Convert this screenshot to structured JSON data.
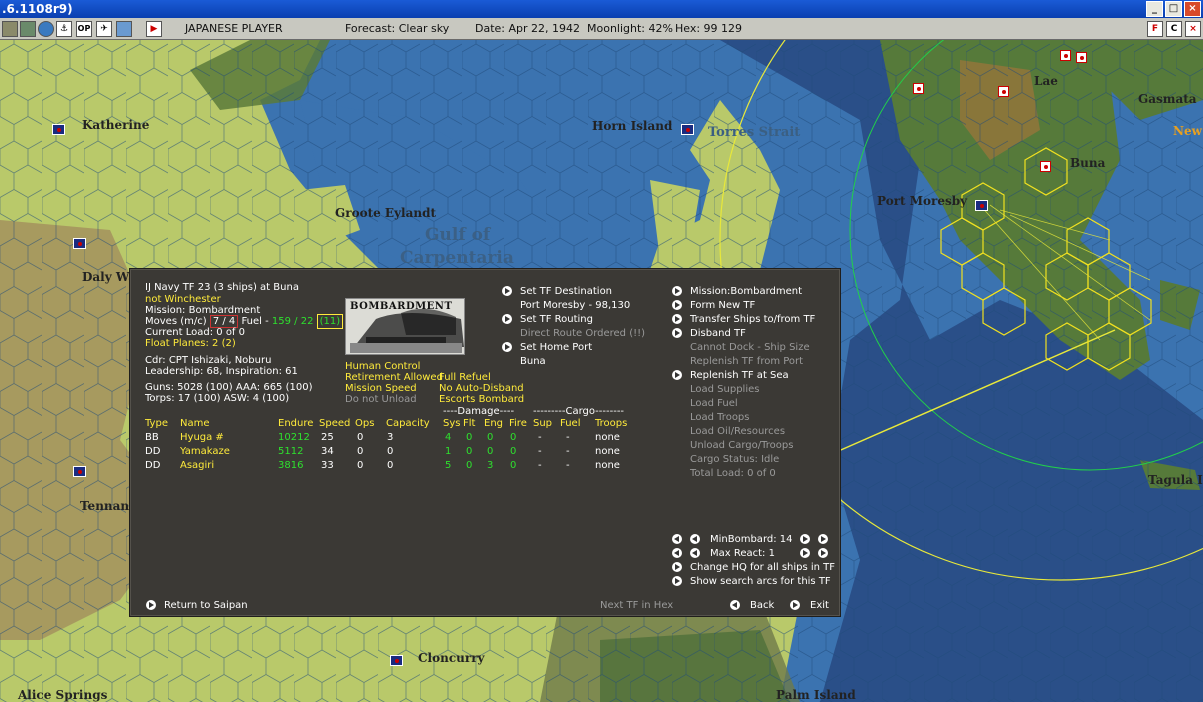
{
  "window": {
    "title": ".6.1108r9)",
    "buttons": [
      "_",
      "□",
      "×"
    ]
  },
  "toolbar": {
    "icons": [
      "map-icon",
      "list-icon",
      "globe-icon",
      "ship-icon",
      "op-icon",
      "air-icon",
      "report-icon",
      "end-turn-icon"
    ],
    "op_label": "OP",
    "player": "JAPANESE PLAYER",
    "forecast": "Forecast: Clear sky",
    "date": "Date: Apr 22, 1942",
    "moonlight": "Moonlight: 42%",
    "hex": "Hex: 99 129",
    "right_buttons": [
      "F",
      "C",
      "×"
    ]
  },
  "map": {
    "labels": [
      {
        "name": "Katherine"
      },
      {
        "name": "Horn Island"
      },
      {
        "name": "Torres Strait"
      },
      {
        "name": "Groote Eylandt"
      },
      {
        "name": "Gulf of"
      },
      {
        "name": "Carpentaria"
      },
      {
        "name": "Daly Wa"
      },
      {
        "name": "Tennant"
      },
      {
        "name": "Alice Springs"
      },
      {
        "name": "Cloncurry"
      },
      {
        "name": "Palm Island"
      },
      {
        "name": "Port Moresby"
      },
      {
        "name": "Buna"
      },
      {
        "name": "Lae"
      },
      {
        "name": "Gasmata"
      },
      {
        "name": "New"
      },
      {
        "name": "Tagula I"
      }
    ]
  },
  "panel": {
    "header": "IJ Navy TF 23 (3 ships) at Buna",
    "status": "not Winchester",
    "mission": "Mission: Bombardment",
    "moves_label": "Moves (m/c)",
    "moves_value": "7 / 4",
    "fuel_label": "Fuel -",
    "fuel_value": "159 / 22",
    "fuel_extra": "(11)",
    "current_load": "Current Load: 0 of 0",
    "float_planes": "Float Planes: 2 (2)",
    "commander": "Cdr: CPT  Ishizaki, Noburu",
    "leadership": "Leadership: 68, Inspiration: 61",
    "guns": "Guns: 5028 (100)  AAA: 665 (100)",
    "torps": "Torps: 17 (100)    ASW: 4 (100)",
    "mission_image_caption": "BOMBARDMENT",
    "control": [
      {
        "text": "Human Control",
        "col": "yel"
      },
      {
        "text": "Retirement Allowed",
        "col": "yel"
      },
      {
        "text": "Full Refuel",
        "col": "yel"
      },
      {
        "text": "Mission Speed",
        "col": "yel"
      },
      {
        "text": "No Auto-Disband",
        "col": "yel"
      },
      {
        "text": "Do not Unload",
        "col": "gry"
      },
      {
        "text": "Escorts Bombard",
        "col": "yel"
      }
    ],
    "mid_actions": [
      {
        "label": "Set TF Destination",
        "arrow": true
      },
      {
        "label": "Port Moresby - 98,130",
        "arrow": false
      },
      {
        "label": "Set TF Routing",
        "arrow": true
      },
      {
        "label": "Direct Route Ordered (!!)",
        "arrow": false,
        "dim": true
      },
      {
        "label": "Set Home Port",
        "arrow": true
      },
      {
        "label": "Buna",
        "arrow": false
      }
    ],
    "right_actions": [
      {
        "label": "Mission:Bombardment",
        "arrow": true
      },
      {
        "label": "Form New TF",
        "arrow": true
      },
      {
        "label": "Transfer Ships to/from TF",
        "arrow": true
      },
      {
        "label": "Disband TF",
        "arrow": true
      },
      {
        "label": "Cannot Dock - Ship Size",
        "arrow": false,
        "dim": true
      },
      {
        "label": "Replenish TF from Port",
        "arrow": false,
        "dim": true
      },
      {
        "label": "Replenish TF at Sea",
        "arrow": true
      },
      {
        "label": "Load Supplies",
        "arrow": false,
        "dim": true
      },
      {
        "label": "Load Fuel",
        "arrow": false,
        "dim": true
      },
      {
        "label": "Load Troops",
        "arrow": false,
        "dim": true
      },
      {
        "label": "Load Oil/Resources",
        "arrow": false,
        "dim": true
      },
      {
        "label": "Unload Cargo/Troops",
        "arrow": false,
        "dim": true
      },
      {
        "label": "Cargo Status: Idle",
        "arrow": false,
        "dim": true
      },
      {
        "label": "Total Load: 0 of 0",
        "arrow": false,
        "dim": true
      }
    ],
    "group_headers": {
      "damage": "----Damage----",
      "cargo": "---------Cargo--------"
    },
    "columns": [
      "Type",
      "Name",
      "Endure",
      "Speed",
      "Ops",
      "Capacity",
      "Sys",
      "Flt",
      "Eng",
      "Fire",
      "Sup",
      "Fuel",
      "Troops"
    ],
    "ships": [
      {
        "type": "BB",
        "name": "Hyuga #",
        "endure": "10212",
        "speed": "25",
        "ops": "0",
        "capacity": "3",
        "sys": "4",
        "flt": "0",
        "eng": "0",
        "fire": "0",
        "sup": "-",
        "fuel": "-",
        "troops": "none"
      },
      {
        "type": "DD",
        "name": "Yamakaze",
        "endure": "5112",
        "speed": "34",
        "ops": "0",
        "capacity": "0",
        "sys": "1",
        "flt": "0",
        "eng": "0",
        "fire": "0",
        "sup": "-",
        "fuel": "-",
        "troops": "none"
      },
      {
        "type": "DD",
        "name": "Asagiri",
        "endure": "3816",
        "speed": "33",
        "ops": "0",
        "capacity": "0",
        "sys": "5",
        "flt": "0",
        "eng": "3",
        "fire": "0",
        "sup": "-",
        "fuel": "-",
        "troops": "none"
      }
    ],
    "min_bombard": "MinBombard: 14",
    "max_react": "Max React: 1",
    "change_hq": "Change HQ for all ships in TF",
    "show_arcs": "Show search arcs for this TF",
    "return_to": "Return to Saipan",
    "next_tf": "Next TF in Hex",
    "back": "Back",
    "exit": "Exit"
  }
}
